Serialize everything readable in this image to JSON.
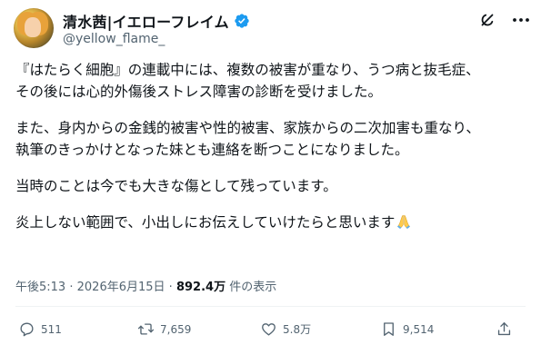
{
  "author": {
    "display_name": "清水茜|イエローフレイム",
    "handle": "@yellow_flame_",
    "verified_color": "#1d9bf0"
  },
  "post": {
    "paragraphs": [
      [
        "『はたらく細胞』の連載中には、複数の被害が重なり、うつ病と抜毛症、",
        "その後には心的外傷後ストレス障害の診断を受けました。"
      ],
      [
        "また、身内からの金銭的被害や性的被害、家族からの二次加害も重なり、",
        "執筆のきっかけとなった妹とも連絡を断つことになりました。"
      ],
      [
        "当時のことは今でも大きな傷として残っています。"
      ],
      [
        "炎上しない範囲で、小出しにお伝えしていけたらと思います"
      ]
    ],
    "emoji": "folded-hands-emoji"
  },
  "meta": {
    "time": "午後5:13",
    "separator1": "·",
    "date": "2026年6月15日",
    "separator2": "·",
    "views_count": "892.4万",
    "views_label": "件の表示"
  },
  "actions": {
    "reply_count": "511",
    "retweet_count": "7,659",
    "like_count": "5.8万",
    "bookmark_count": "9,514"
  },
  "icons": {
    "header": [
      "grok-icon",
      "more-icon"
    ],
    "actions": [
      "reply-icon",
      "retweet-icon",
      "like-icon",
      "bookmark-icon",
      "share-icon"
    ]
  }
}
